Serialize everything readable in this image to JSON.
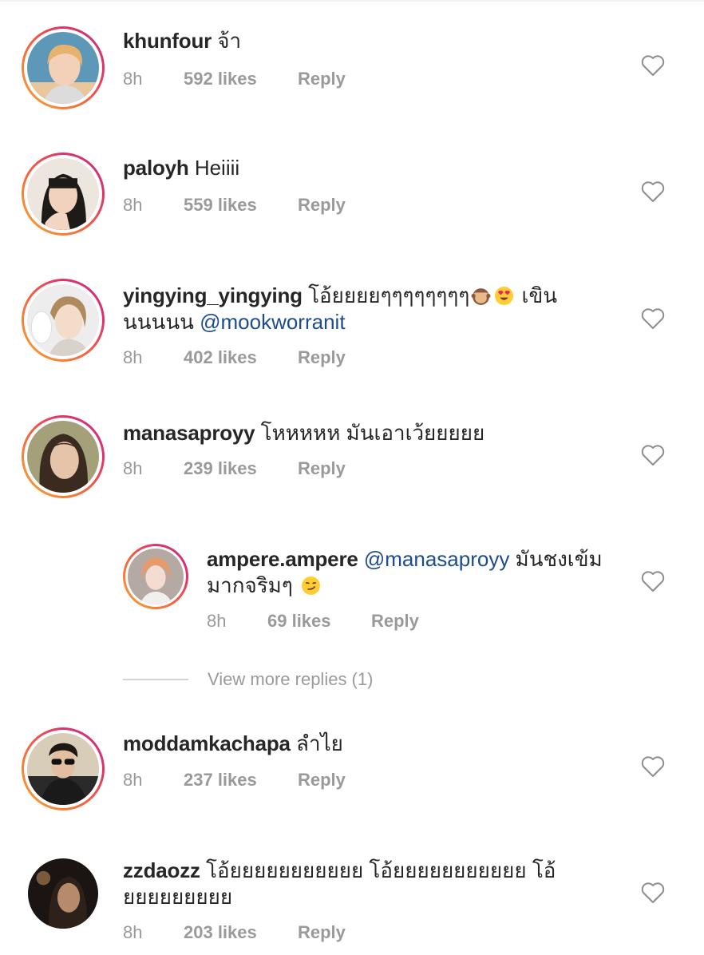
{
  "comments": [
    {
      "username": "khunfour",
      "text": " จ้า",
      "time": "8h",
      "likes": "592 likes",
      "reply": "Reply",
      "has_story_ring": true,
      "avatar_icon": "profile-photo"
    },
    {
      "username": "paloyh",
      "text": " Heiiii",
      "time": "8h",
      "likes": "559 likes",
      "reply": "Reply",
      "has_story_ring": true,
      "avatar_icon": "profile-photo"
    },
    {
      "username": "yingying_yingying",
      "text_line1": " โอ้ยยยยๆๆๆๆๆๆๆๆ",
      "text_line1_after": " เขิน",
      "emojis": [
        "see-no-evil-monkey-emoji",
        "heart-eyes-emoji"
      ],
      "text_line2": "นนนนน ",
      "mention": "@mookworranit",
      "time": "8h",
      "likes": "402 likes",
      "reply": "Reply",
      "has_story_ring": true,
      "avatar_icon": "profile-photo"
    },
    {
      "username": "manasaproyy",
      "text": " โหหหหห มันเอาเว้ยยยยย",
      "time": "8h",
      "likes": "239 likes",
      "reply": "Reply",
      "has_story_ring": true,
      "avatar_icon": "profile-photo"
    },
    {
      "username": "moddamkachapa",
      "text": " ลำไย",
      "time": "8h",
      "likes": "237 likes",
      "reply": "Reply",
      "has_story_ring": true,
      "avatar_icon": "profile-photo"
    },
    {
      "username": "zzdaozz",
      "text_line1": " โอ้ยยยยยยยยยยย โอ้ยยยยยยยยยยย โอ้",
      "text_line2": "ยยยยยยยยย",
      "time": "8h",
      "likes": "203 likes",
      "reply": "Reply",
      "has_story_ring": false,
      "avatar_icon": "profile-photo"
    }
  ],
  "reply_thread": {
    "username": "ampere.ampere",
    "mention": " @manasaproyy",
    "text_line1_after": " มันชงเข้ม",
    "text_line2": "มากจริมๆ",
    "emoji": "smirk-face-emoji",
    "time": "8h",
    "likes": "69 likes",
    "reply": "Reply",
    "has_story_ring": true,
    "avatar_icon": "profile-photo"
  },
  "view_more_replies": "View more replies (1)",
  "colors": {
    "text": "#262626",
    "meta": "#9a9a9a",
    "mention": "#1d4d8c",
    "ring_start": "#f9a832",
    "ring_end": "#c13584"
  }
}
